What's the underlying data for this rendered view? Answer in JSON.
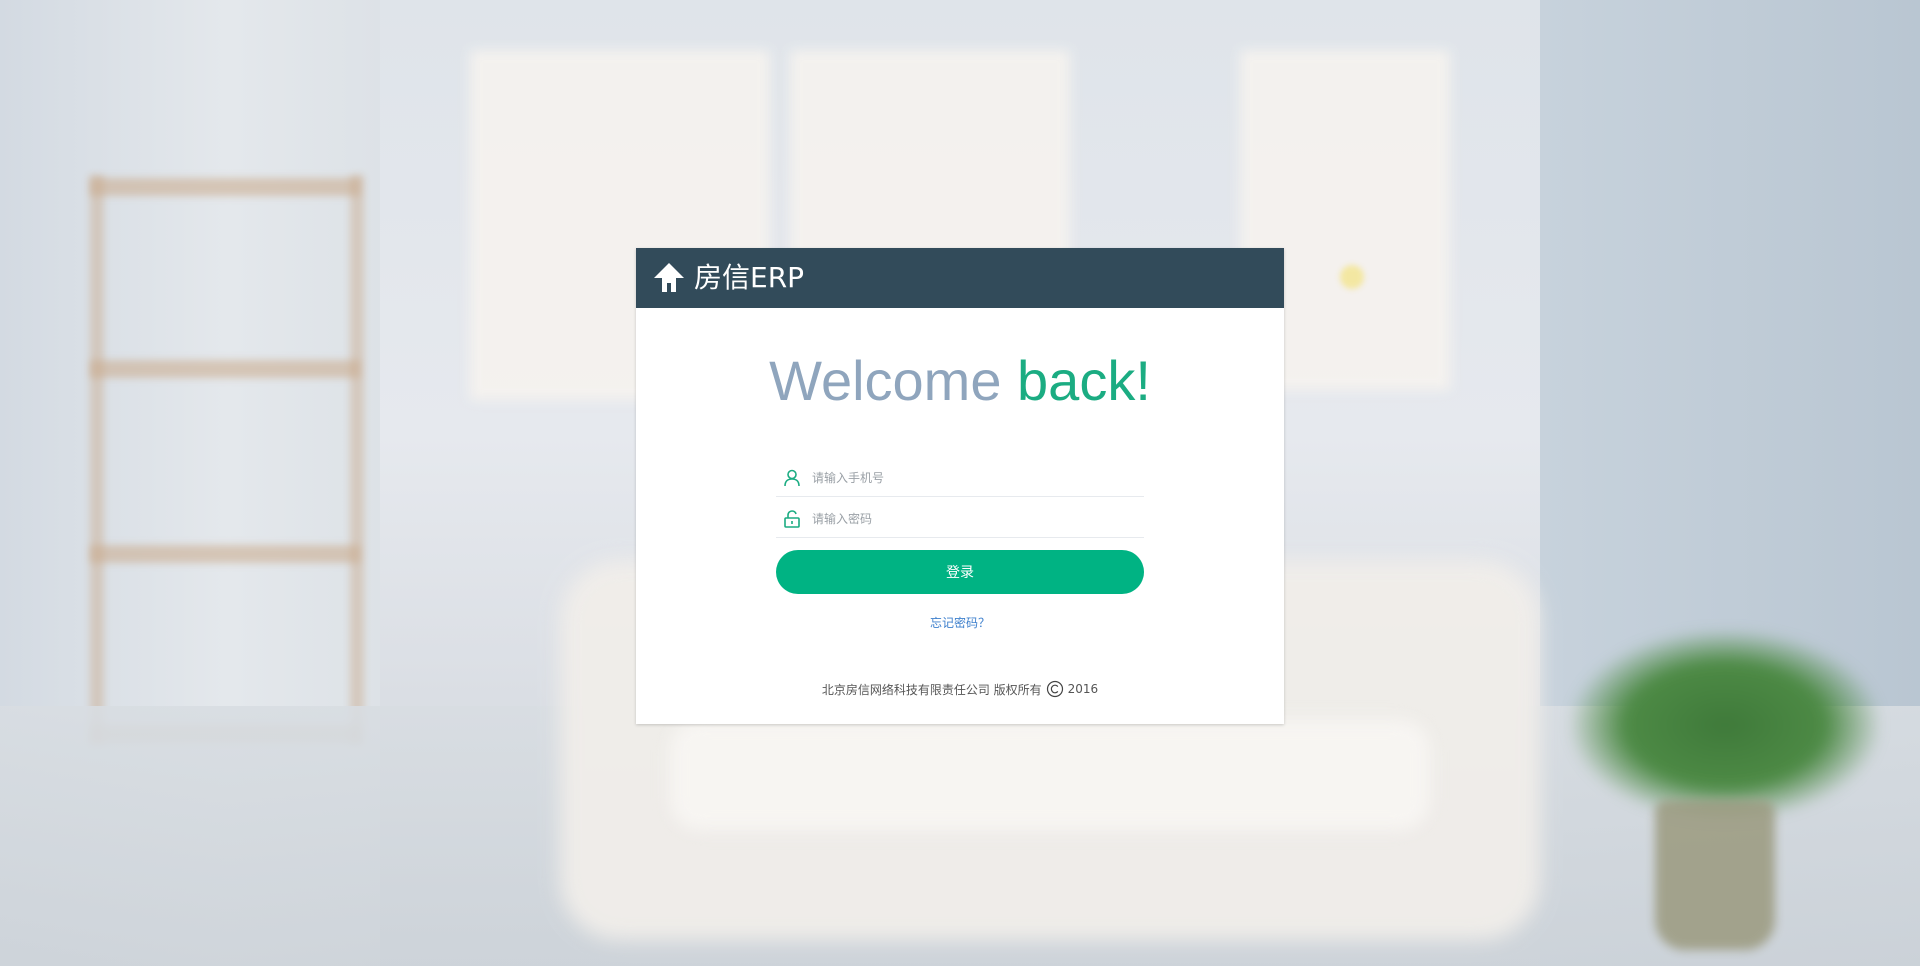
{
  "brand": {
    "name": "房信ERP"
  },
  "welcome": {
    "part1": "Welcome",
    "part2": "back!"
  },
  "form": {
    "phone_placeholder": "请输入手机号",
    "password_placeholder": "请输入密码",
    "login_label": "登录",
    "forgot_label": "忘记密码？"
  },
  "footer": {
    "company": "北京房信网络科技有限责任公司 版权所有",
    "year": "2016"
  },
  "colors": {
    "header": "#324b5a",
    "accent": "#00b383",
    "welcome_gray": "#8fa5bd",
    "link": "#3d7fcc"
  },
  "icons": [
    "house-arrow-icon",
    "user-icon",
    "lock-icon",
    "copyright-icon"
  ]
}
